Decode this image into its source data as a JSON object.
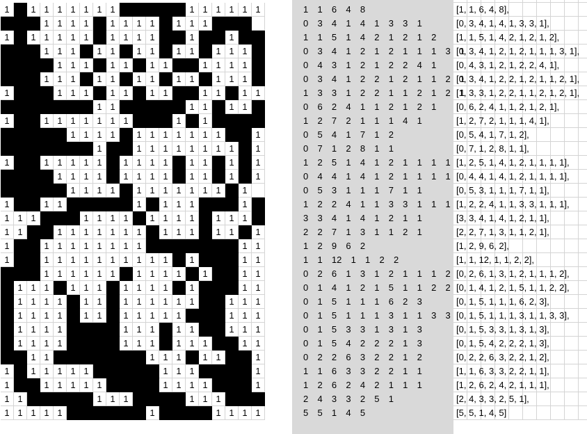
{
  "grid_rows": [
    "1B1111111BBBBB111111111",
    "BBB1111B1111B111BBB.B1",
    "1B11111B1111BB1BB1BB",
    "BBB111B11B11B11B111B",
    "BBBB111B11B11BB1111B",
    "BBB111B11B11B11B111B",
    "1BBB111B11B11BB11B11B",
    "BBBBBBB11BBBBB11B11B11B",
    "1BB1111111BBB1B1BBBBB1",
    "BBBBB1111B1111111BB11",
    "BBBBBBB1BB11111111B1",
    "1BB11111B1111B11B1B1",
    "BBBB1111B1111B11B1B1",
    "BBBBB1111B1111111B1",
    "1BB11BBBBB1B111BBB1B1",
    "111BBB1111B1111B111B1",
    "11BB1111111B111B11B1",
    "1BB11111111BBBBBBB11",
    "1BB1111111111B1BBB11",
    "BBB111111B1111B1BB11",
    "B111B111B1111B1BBB11",
    "B1111B11B111111BB111",
    "B1111B11B11111BBB111",
    "B1111BBBB111B11BB111",
    "B1111BBBB111B111BB11",
    "BB11BBBBBBB111B11BB1",
    "1B11111BBBBB111BBBB1",
    "1BB11111BBBB1111BBB1",
    "11BBBBB111BBBB111BBB",
    "11111BBBBBB1BBBB11111"
  ],
  "clues": [
    "1  1  6  4  8",
    "0  3  4  1  4  1  3  3  1",
    "1  1  5  1  4  2  1  2  1  2",
    "0  3  4  1  2  1  2  1  1  1  3  1",
    "0  4  3  1  2  1  2  2  4  1",
    "0  3  4  1  2  2  1  2  1  1  2  1",
    "1  3  3  1  2  2  1  1  2  1  2  1",
    "0  6  2  4  1  1  2  1  2  1",
    "1  2  7  2  1  1  1  4  1",
    "0  5  4  1  7  1  2",
    "0  7  1  2  8  1  1",
    "1  2  5  1  4  1  2  1  1  1  1",
    "0  4  4  1  4  1  2  1  1  1  1",
    "0  5  3  1  1  1  7  1  1",
    "1  2  2  4  1  1  3  3  1  1  1",
    "3  3  4  1  4  1  2  1  1",
    "2  2  7  1  3  1  1  2  1",
    "1  2  9  6  2",
    "1  1  12  1  1  2  2",
    "0  2  6  1  3  1  2  1  1  1  2",
    "0  1  4  1  2  1  5  1  1  2  2",
    "0  1  5  1  1  1  6  2  3",
    "0  1  5  1  1  1  3  1  1  3  3",
    "0  1  5  3  3  1  3  1  3",
    "0  1  5  4  2  2  2  1  3",
    "0  2  2  6  3  2  2  1  2",
    "1  1  6  3  3  2  2  1  1",
    "1  2  6  2  4  2  1  1  1",
    "2  4  3  3  2  5  1",
    "5  5  1  4  5"
  ],
  "arrays": [
    "[1, 1, 6, 4, 8],",
    "[0, 3, 4, 1, 4, 1, 3, 3, 1],",
    "[1, 1, 5, 1, 4, 2, 1, 2, 1, 2],",
    "[0, 3, 4, 1, 2, 1, 2, 1, 1, 1, 3, 1],",
    "[0, 4, 3, 1, 2, 1, 2, 2, 4, 1],",
    "[0, 3, 4, 1, 2, 2, 1, 2, 1, 1, 2, 1],",
    "[1, 3, 3, 1, 2, 2, 1, 1, 2, 1, 2, 1],",
    "[0, 6, 2, 4, 1, 1, 2, 1, 2, 1],",
    "[1, 2, 7, 2, 1, 1, 1, 4, 1],",
    "[0, 5, 4, 1, 7, 1, 2],",
    "[0, 7, 1, 2, 8, 1, 1],",
    "[1, 2, 5, 1, 4, 1, 2, 1, 1, 1, 1],",
    "[0, 4, 4, 1, 4, 1, 2, 1, 1, 1, 1],",
    "[0, 5, 3, 1, 1, 1, 7, 1, 1],",
    "[1, 2, 2, 4, 1, 1, 3, 3, 1, 1, 1],",
    "[3, 3, 4, 1, 4, 1, 2, 1, 1],",
    "[2, 2, 7, 1, 3, 1, 1, 2, 1],",
    "[1, 2, 9, 6, 2],",
    "[1, 1, 12, 1, 1, 2, 2],",
    "[0, 2, 6, 1, 3, 1, 2, 1, 1, 1, 2],",
    "[0, 1, 4, 1, 2, 1, 5, 1, 1, 2, 2],",
    "[0, 1, 5, 1, 1, 1, 6, 2, 3],",
    "[0, 1, 5, 1, 1, 1, 3, 1, 1, 3, 3],",
    "[0, 1, 5, 3, 3, 1, 3, 1, 3],",
    "[0, 1, 5, 4, 2, 2, 2, 1, 3],",
    "[0, 2, 2, 6, 3, 2, 2, 1, 2],",
    "[1, 1, 6, 3, 3, 2, 2, 1, 1],",
    "[1, 2, 6, 2, 4, 2, 1, 1, 1],",
    "[2, 4, 3, 3, 2, 5, 1],",
    "[5, 5, 1, 4, 5]"
  ],
  "colors": {
    "black": "#000000",
    "panel": "#d9d9d9",
    "gridline": "#d4d4d4"
  }
}
